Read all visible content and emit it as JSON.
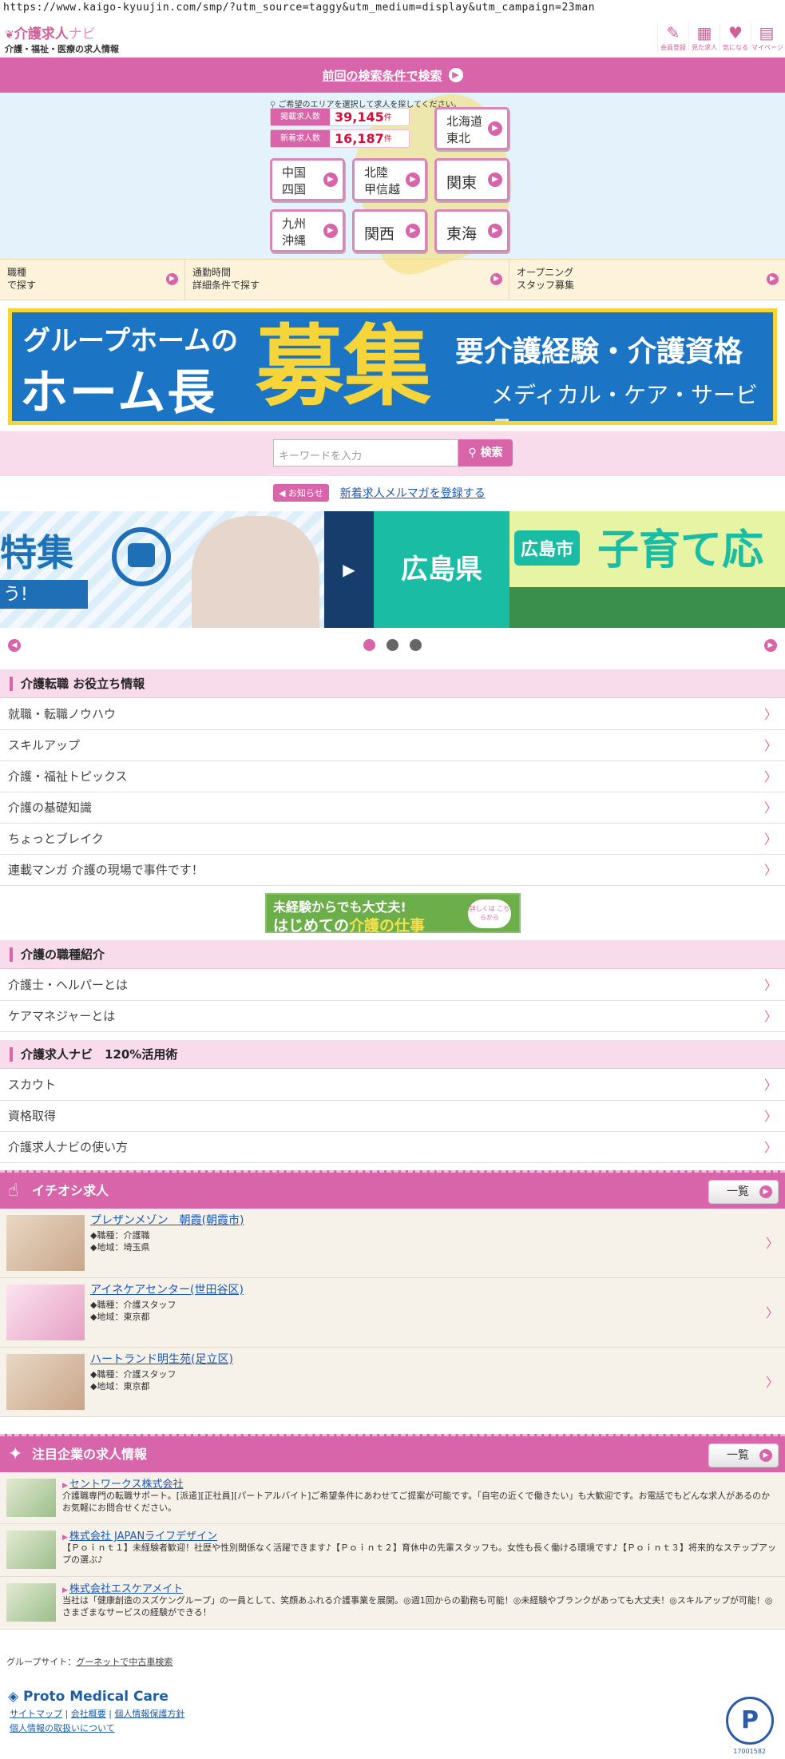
{
  "browser": {
    "url": "https://www.kaigo-kyuujin.com/smp/?utm_source=taggy&utm_medium=display&utm_campaign=23man"
  },
  "header": {
    "logo_main": "介護求人",
    "logo_navi": "ナビ",
    "logo_sub": "介護・福祉・医療の求人情報",
    "icons": [
      {
        "icon": "pencil-icon",
        "glyph": "✎",
        "label": "会員登録"
      },
      {
        "icon": "calendar-icon",
        "glyph": "▦",
        "label": "見た求人"
      },
      {
        "icon": "heart-icon",
        "glyph": "♥",
        "label": "気になる"
      },
      {
        "icon": "mypage-icon",
        "glyph": "▤",
        "label": "マイページ"
      }
    ]
  },
  "prev_search": {
    "label": "前回の検索条件で検索"
  },
  "map": {
    "hint": "ご希望のエリアを選択して求人を探してください。",
    "counts": [
      {
        "label": "掲載求人数",
        "value": "39,145",
        "unit": "件"
      },
      {
        "label": "新着求人数",
        "value": "16,187",
        "unit": "件"
      }
    ],
    "areas": {
      "hokkaido": "北海道\n東北",
      "chugoku": "中国\n四国",
      "hokuriku": "北陸\n甲信越",
      "kanto": "関東",
      "kyushu": "九州\n沖縄",
      "kansai": "関西",
      "tokai": "東海"
    }
  },
  "subnav": [
    {
      "line1": "職種",
      "line2": "で探す"
    },
    {
      "line1": "通勤時間",
      "line2": "詳細条件で探す"
    },
    {
      "line1": "オープニング",
      "line2": "スタッフ募集"
    }
  ],
  "hero_banner": {
    "line1": "グループホームの",
    "line2": "ホーム長",
    "big": "募集",
    "right1": "要介護経験・介護資格",
    "right2": "メディカル・ケア・サービス"
  },
  "search": {
    "placeholder": "キーワードを入力",
    "button": "検索"
  },
  "notice": {
    "tag": "お知らせ",
    "link": "新着求人メルマガを登録する"
  },
  "carousel": {
    "slide1_text": "特集",
    "slide1_band": "う!",
    "slide2_pref": "広島県",
    "slide2_pill": "広島市",
    "slide2_big": "子育て応"
  },
  "sections": {
    "tips_title": "介護転職 お役立ち情報",
    "tips": [
      "就職・転職ノウハウ",
      "スキルアップ",
      "介護・福祉トピックス",
      "介護の基礎知識",
      "ちょっとブレイク",
      "連載マンガ 介護の現場で事件です！"
    ],
    "jobs_title": "介護の職種紹介",
    "jobs": [
      "介護士・ヘルパーとは",
      "ケアマネジャーとは"
    ],
    "use_title": "介護求人ナビ　120%活用術",
    "use": [
      "スカウト",
      "資格取得",
      "介護求人ナビの使い方"
    ]
  },
  "mini_banner": {
    "line1": "未経験からでも大丈夫!",
    "line2_a": "はじめての",
    "line2_b": "介護の仕事",
    "cta": "詳しくは こちらから"
  },
  "pickup": {
    "title": "イチオシ求人",
    "all_label": "一覧",
    "items": [
      {
        "name": "プレザンメゾン　朝霞(朝霞市)",
        "job": "◆職種：介護職",
        "area": "◆地域：埼玉県"
      },
      {
        "name": "アイネケアセンター(世田谷区)",
        "job": "◆職種：介護スタッフ",
        "area": "◆地域：東京都"
      },
      {
        "name": "ハートランド明生苑(足立区)",
        "job": "◆職種：介護スタッフ",
        "area": "◆地域：東京都"
      }
    ]
  },
  "companies": {
    "title": "注目企業の求人情報",
    "all_label": "一覧",
    "items": [
      {
        "name": "セントワークス株式会社",
        "desc": "介護職専門の転職サポート。[派遣][正社員][パートアルバイト]ご希望条件にあわせてご提案が可能です。「自宅の近くで働きたい」も大歓迎です。お電話でもどんな求人があるのかお気軽にお問合せください。"
      },
      {
        "name": "株式会社 JAPANライフデザイン",
        "desc": "【Ｐｏｉｎｔ１】未経験者歓迎！社歴や性別関係なく活躍できます♪【Ｐｏｉｎｔ２】育休中の先輩スタッフも。女性も長く働ける環境です♪【Ｐｏｉｎｔ３】将来的なステップアップの選ぶ♪"
      },
      {
        "name": "株式会社エスケアメイト",
        "desc": "当社は「健康創造のスズケングループ」の一員として、笑顔あふれる介護事業を展開。◎週1回からの勤務も可能！◎未経験やブランクがあっても大丈夫！◎スキルアップが可能！◎さまざまなサービスの経験ができる！"
      }
    ]
  },
  "footer": {
    "group_label": "グループサイト：",
    "group_link": "グーネットで中古車検索",
    "brand": "Proto Medical Care",
    "links": [
      "サイトマップ",
      "会社概要",
      "個人情報保護方針",
      "個人情報の取扱いについて"
    ],
    "privacy_number": "17001582"
  },
  "colors": {
    "accent": "#d864a9",
    "link": "#1a58b5",
    "sect_bg": "#f9dcec"
  }
}
